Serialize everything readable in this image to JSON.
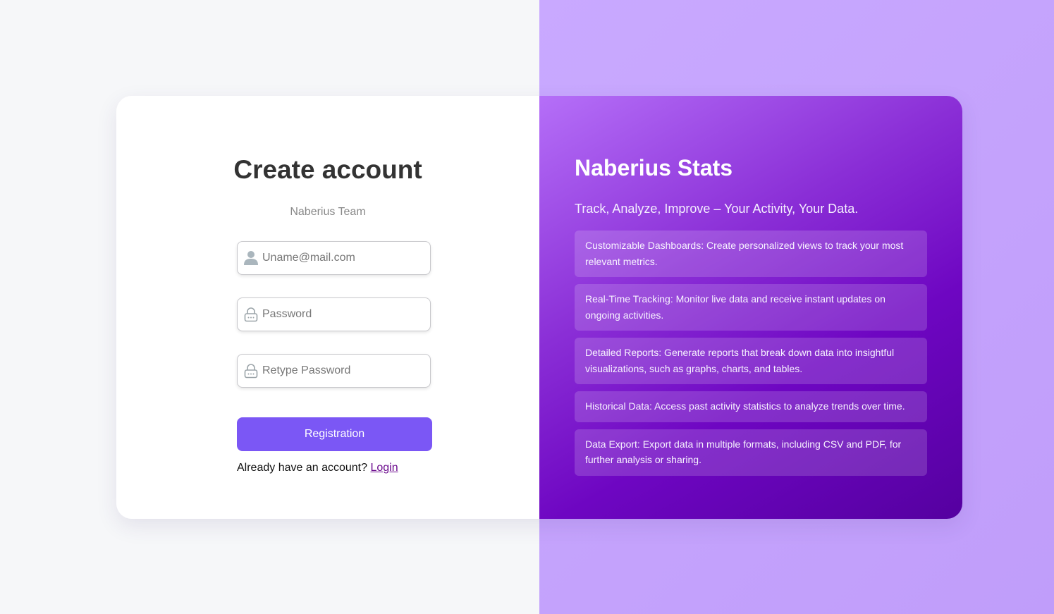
{
  "form": {
    "title": "Create account",
    "subtitle": "Naberius Team",
    "email_placeholder": "Uname@mail.com",
    "password_placeholder": "Password",
    "retype_placeholder": "Retype Password",
    "submit_label": "Registration",
    "login_prompt": "Already have an account?",
    "login_link": "Login",
    "icons": {
      "email": "user-icon",
      "password": "lock-icon",
      "retype": "lock-icon"
    }
  },
  "promo": {
    "brand": "Naberius Stats",
    "tagline": "Track, Analyze, Improve – Your Activity, Your Data.",
    "features": [
      "Customizable Dashboards: Create personalized views to track your most relevant metrics.",
      "Real-Time Tracking: Monitor live data and receive instant updates on ongoing activities.",
      "Detailed Reports: Generate reports that break down data into insightful visualizations, such as graphs, charts, and tables.",
      "Historical Data: Access past activity statistics to analyze trends over time.",
      "Data Export: Export data in multiple formats, including CSV and PDF, for further analysis or sharing."
    ]
  },
  "colors": {
    "accent": "#7b57f5",
    "promo_gradient_start": "#b56ff8",
    "promo_gradient_end": "#5500a0",
    "background_left": "#f6f7f9",
    "background_right": "#c9a9ff",
    "link": "#6b0a8d"
  }
}
